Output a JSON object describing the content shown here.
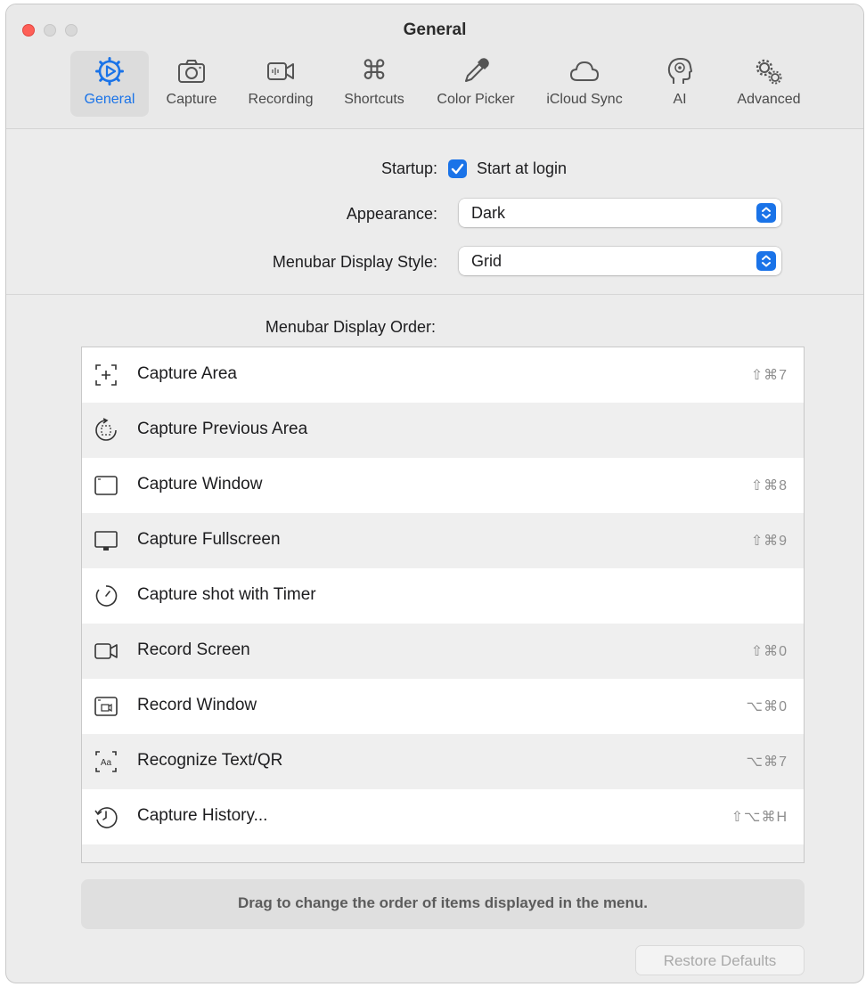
{
  "window": {
    "title": "General"
  },
  "toolbar": {
    "tabs": [
      {
        "label": "General",
        "icon": "gear-play-icon",
        "active": true
      },
      {
        "label": "Capture",
        "icon": "camera-icon",
        "active": false
      },
      {
        "label": "Recording",
        "icon": "video-camera-icon",
        "active": false
      },
      {
        "label": "Shortcuts",
        "icon": "command-icon",
        "active": false
      },
      {
        "label": "Color Picker",
        "icon": "eyedropper-icon",
        "active": false
      },
      {
        "label": "iCloud Sync",
        "icon": "cloud-icon",
        "active": false
      },
      {
        "label": "AI",
        "icon": "brain-icon",
        "active": false
      },
      {
        "label": "Advanced",
        "icon": "gears-icon",
        "active": false
      }
    ]
  },
  "settings": {
    "startup_label": "Startup:",
    "startup_checkbox_label": "Start at login",
    "startup_checked": true,
    "appearance_label": "Appearance:",
    "appearance_value": "Dark",
    "menubar_style_label": "Menubar Display Style:",
    "menubar_style_value": "Grid"
  },
  "order": {
    "label": "Menubar Display Order:",
    "items": [
      {
        "label": "Capture Area",
        "shortcut": "⇧⌘7",
        "icon": "capture-area-icon"
      },
      {
        "label": "Capture Previous Area",
        "shortcut": "",
        "icon": "capture-previous-area-icon"
      },
      {
        "label": "Capture Window",
        "shortcut": "⇧⌘8",
        "icon": "window-icon"
      },
      {
        "label": "Capture Fullscreen",
        "shortcut": "⇧⌘9",
        "icon": "display-icon"
      },
      {
        "label": "Capture shot with Timer",
        "shortcut": "",
        "icon": "timer-icon"
      },
      {
        "label": "Record Screen",
        "shortcut": "⇧⌘0",
        "icon": "video-icon"
      },
      {
        "label": "Record Window",
        "shortcut": "⌥⌘0",
        "icon": "record-window-icon"
      },
      {
        "label": "Recognize Text/QR",
        "shortcut": "⌥⌘7",
        "icon": "text-recognition-icon"
      },
      {
        "label": "Capture History...",
        "shortcut": "⇧⌥⌘H",
        "icon": "history-icon"
      }
    ]
  },
  "hint": "Drag to change the order of items displayed in the menu.",
  "restore_label": "Restore Defaults",
  "colors": {
    "accent": "#1a73e8",
    "close": "#fe5f57"
  }
}
